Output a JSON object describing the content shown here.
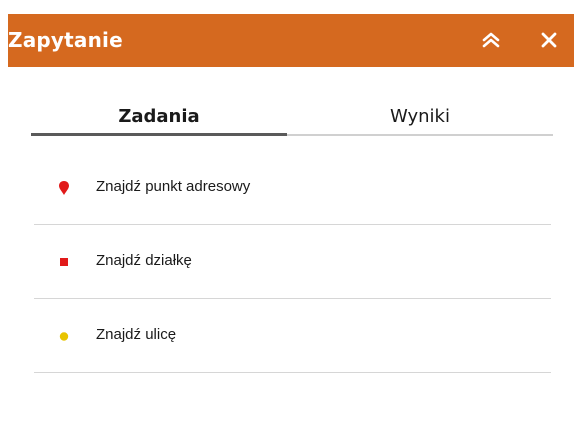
{
  "header": {
    "title": "Zapytanie",
    "collapse_icon": "double-chevron-up-icon",
    "close_icon": "close-icon",
    "background_color": "#d5691f"
  },
  "tabs": [
    {
      "label": "Zadania",
      "active": true
    },
    {
      "label": "Wyniki",
      "active": false
    }
  ],
  "tasks": [
    {
      "label": "Znajdź punkt adresowy",
      "icon": "map-pin-icon",
      "color": "#e11a1a"
    },
    {
      "label": "Znajdź działkę",
      "icon": "square-icon",
      "color": "#e11a1a"
    },
    {
      "label": "Znajdź ulicę",
      "icon": "circle-icon",
      "color": "#e8c400"
    }
  ]
}
